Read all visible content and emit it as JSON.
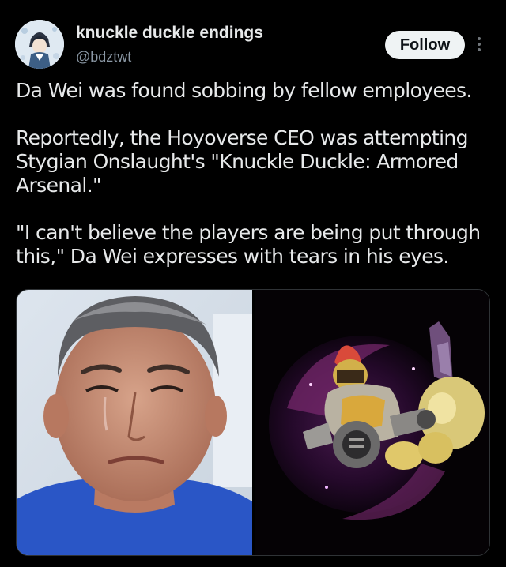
{
  "author": {
    "display_name": "knuckle duckle endings",
    "handle": "@bdztwt"
  },
  "actions": {
    "follow_label": "Follow",
    "more_icon": "more-vertical-icon"
  },
  "tweet": {
    "paragraphs": [
      "Da Wei was found sobbing by fellow employees.",
      "Reportedly, the Hoyoverse CEO was attempting Stygian Onslaught's \"Knuckle Duckle: Armored Arsenal.\"",
      "\"I can't believe the players are being put through this,\" Da Wei expresses with tears in his eyes."
    ]
  },
  "colors": {
    "background": "#000000",
    "text": "#e7e9ea",
    "secondary": "#8b98a5",
    "follow_bg": "#eff3f4"
  }
}
